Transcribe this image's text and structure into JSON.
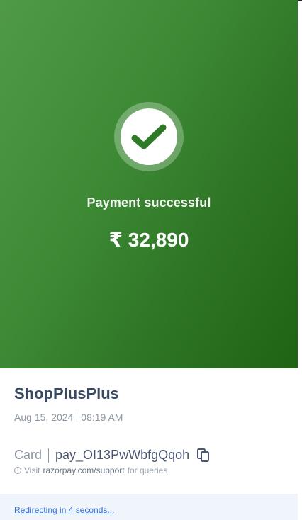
{
  "status": {
    "icon": "check-icon",
    "message": "Payment successful",
    "amount": "₹ 32,890"
  },
  "merchant": {
    "name": "ShopPlusPlus",
    "date": "Aug 15, 2024",
    "time": "08:19 AM"
  },
  "payment": {
    "method": "Card",
    "payment_id": "pay_OI13PwWbfgQqoh",
    "copy_icon": "copy-icon"
  },
  "support": {
    "icon": "info-icon",
    "prefix": "Visit",
    "link": "razorpay.com/support",
    "suffix": "for queries"
  },
  "redirect": {
    "text": "Redirecting in 4 seconds..."
  },
  "colors": {
    "hero_start": "#4f9a47",
    "hero_end": "#1f6314",
    "check": "#2f7a27",
    "link": "#3a6fd8",
    "redirect_bg": "#f0f5fc"
  }
}
